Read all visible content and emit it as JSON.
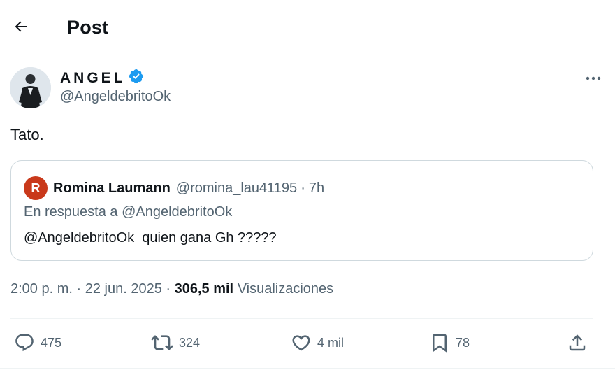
{
  "header": {
    "title": "Post"
  },
  "author": {
    "display_name": "ANGEL",
    "handle": "@AngeldebritoOk",
    "verified": true
  },
  "tweet": {
    "text": "Tato."
  },
  "quote": {
    "avatar_letter": "R",
    "name": "Romina Laumann",
    "handle": "@romina_lau41195",
    "separator": "·",
    "time": "7h",
    "reply_to": "En respuesta a @AngeldebritoOk",
    "text": "@AngeldebritoOk  quien gana Gh ?????"
  },
  "meta": {
    "time": "2:00 p. m.",
    "separator": " · ",
    "date": "22 jun. 2025",
    "views_count": "306,5 mil",
    "views_label": "Visualizaciones"
  },
  "actions": {
    "replies": "475",
    "reposts": "324",
    "likes": "4 mil",
    "bookmarks": "78"
  },
  "colors": {
    "text": "#0f1419",
    "secondary": "#536471",
    "verified": "#1d9bf0",
    "border": "#cfd9de",
    "quote_avatar": "#c9391b"
  }
}
